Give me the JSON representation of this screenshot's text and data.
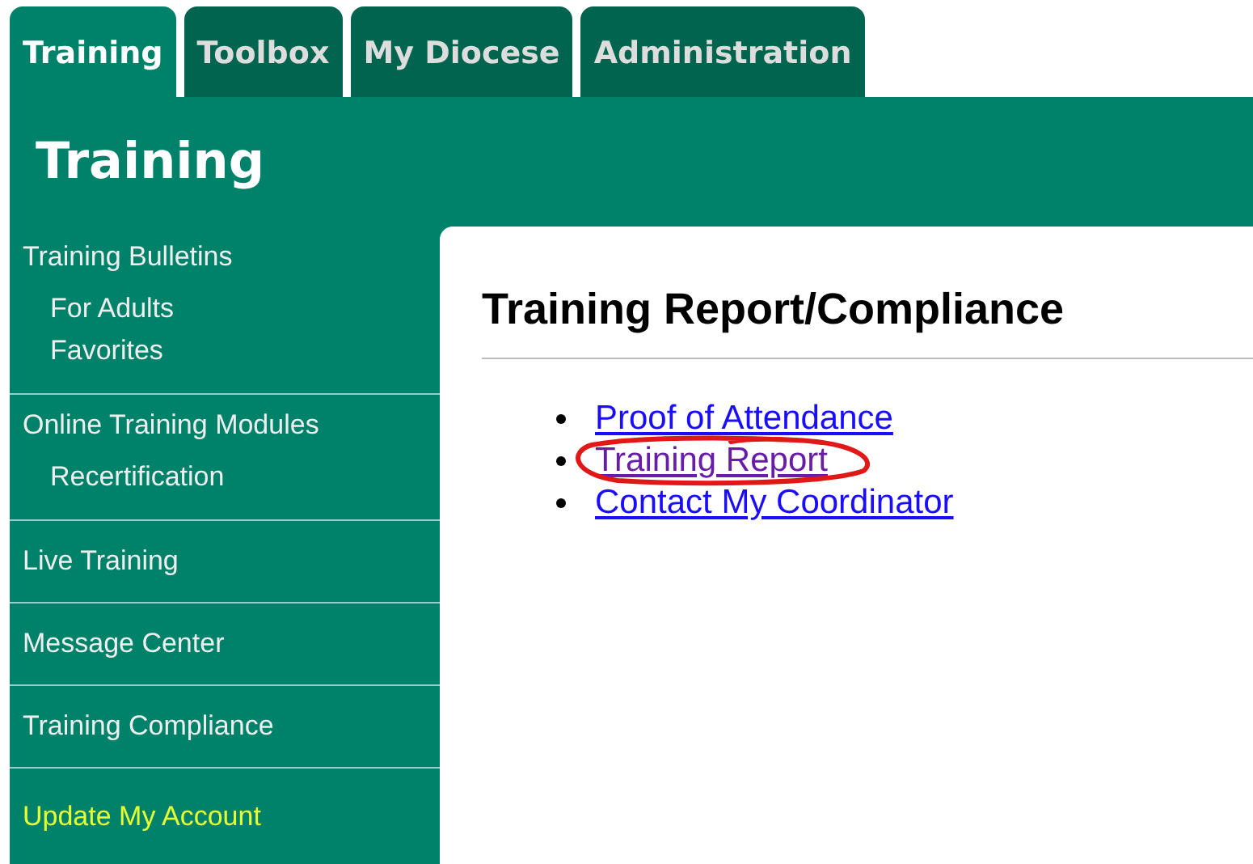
{
  "tabs": [
    {
      "label": "Training",
      "selected": true
    },
    {
      "label": "Toolbox",
      "selected": false
    },
    {
      "label": "My Diocese",
      "selected": false
    },
    {
      "label": "Administration",
      "selected": false
    }
  ],
  "section_title": "Training",
  "sidebar": {
    "items": [
      {
        "label": "Training Bulletins",
        "highlighted": false,
        "children": [
          {
            "label": "For Adults"
          },
          {
            "label": "Favorites"
          }
        ]
      },
      {
        "label": "Online Training Modules",
        "highlighted": false,
        "children": [
          {
            "label": "Recertification"
          }
        ]
      },
      {
        "label": "Live Training",
        "highlighted": false
      },
      {
        "label": "Message Center",
        "highlighted": false
      },
      {
        "label": "Training Compliance",
        "highlighted": false
      },
      {
        "label": "Update My Account",
        "highlighted": true
      }
    ]
  },
  "content": {
    "title": "Training Report/Compliance",
    "links": [
      {
        "label": "Proof of Attendance",
        "visited": false,
        "circled": false
      },
      {
        "label": "Training Report",
        "visited": true,
        "circled": true
      },
      {
        "label": "Contact My Coordinator",
        "visited": false,
        "circled": false
      }
    ]
  }
}
